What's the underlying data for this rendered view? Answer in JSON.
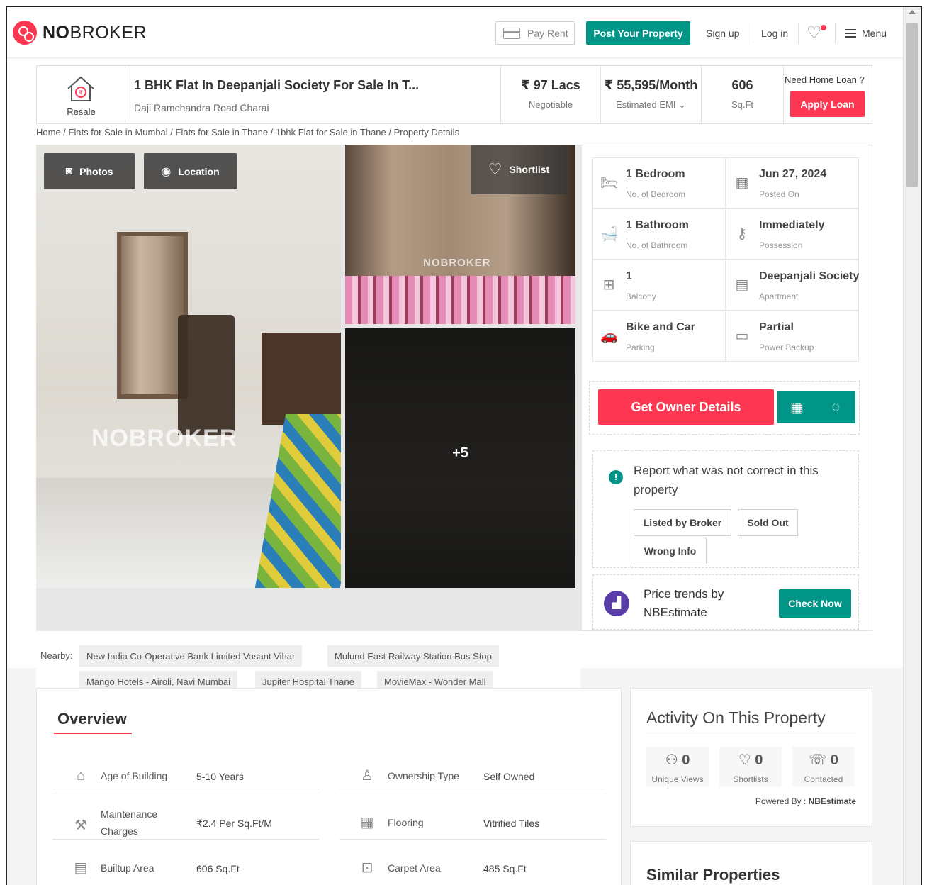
{
  "header": {
    "logo_prefix": "NO",
    "logo_suffix": "BROKER",
    "pay_rent": "Pay Rent",
    "post_property": "Post Your Property",
    "sign_up": "Sign up",
    "log_in": "Log in",
    "menu": "Menu"
  },
  "listing": {
    "badge": "Resale",
    "title": "1 BHK Flat In Deepanjali Society For Sale In T...",
    "address": "Daji Ramchandra Road Charai",
    "price": "₹ 97 Lacs",
    "price_note": "Negotiable",
    "emi": "₹ 55,595/Month",
    "emi_note": "Estimated EMI",
    "area": "606",
    "area_unit": "Sq.Ft",
    "loan_question": "Need Home Loan ?",
    "apply_loan": "Apply Loan"
  },
  "breadcrumb": "Home / Flats for Sale in Mumbai / Flats for Sale in Thane / 1bhk Flat for Sale in Thane / Property Details",
  "gallery": {
    "photos": "Photos",
    "location": "Location",
    "shortlist": "Shortlist",
    "more_count": "+5",
    "watermark": "NOBROKER"
  },
  "specs": [
    {
      "value": "1 Bedroom",
      "label": "No. of Bedroom",
      "icon": "bed-icon"
    },
    {
      "value": "Jun 27, 2024",
      "label": "Posted On",
      "icon": "calendar-icon"
    },
    {
      "value": "1 Bathroom",
      "label": "No. of Bathroom",
      "icon": "bathtub-icon"
    },
    {
      "value": "Immediately",
      "label": "Possession",
      "icon": "key-icon"
    },
    {
      "value": "1",
      "label": "Balcony",
      "icon": "balcony-icon"
    },
    {
      "value": "Deepanjali Society",
      "label": "Apartment",
      "icon": "building-icon"
    },
    {
      "value": "Bike and Car",
      "label": "Parking",
      "icon": "car-icon"
    },
    {
      "value": "Partial",
      "label": "Power Backup",
      "icon": "battery-icon"
    }
  ],
  "owner": {
    "button": "Get Owner Details"
  },
  "report": {
    "text": "Report what was not correct in this property",
    "chips": [
      "Listed by Broker",
      "Sold Out",
      "Wrong Info"
    ]
  },
  "trends": {
    "text": "Price trends by NBEstimate",
    "button": "Check Now"
  },
  "nearby": {
    "label": "Nearby:",
    "items": [
      "New India Co-Operative Bank Limited Vasant Vihar",
      "Mulund East Railway Station Bus Stop",
      "Mango Hotels - Airoli, Navi Mumbai",
      "Jupiter Hospital Thane",
      "MovieMax - Wonder Mall"
    ]
  },
  "overview": {
    "title": "Overview",
    "rows": [
      {
        "label": "Age of Building",
        "value": "5-10 Years"
      },
      {
        "label": "Ownership Type",
        "value": "Self Owned"
      },
      {
        "label": "Maintenance Charges",
        "value": "₹2.4 Per Sq.Ft/M"
      },
      {
        "label": "Flooring",
        "value": "Vitrified Tiles"
      },
      {
        "label": "Builtup Area",
        "value": "606 Sq.Ft"
      },
      {
        "label": "Carpet Area",
        "value": "485 Sq.Ft"
      }
    ]
  },
  "activity": {
    "title": "Activity On This Property",
    "stats": [
      {
        "count": "0",
        "label": "Unique Views"
      },
      {
        "count": "0",
        "label": "Shortlists"
      },
      {
        "count": "0",
        "label": "Contacted"
      }
    ],
    "powered_label": "Powered By :",
    "powered_by": "NBEstimate"
  },
  "similar": {
    "title": "Similar Properties"
  },
  "colors": {
    "brand_red": "#fd3752",
    "teal": "#009587"
  }
}
